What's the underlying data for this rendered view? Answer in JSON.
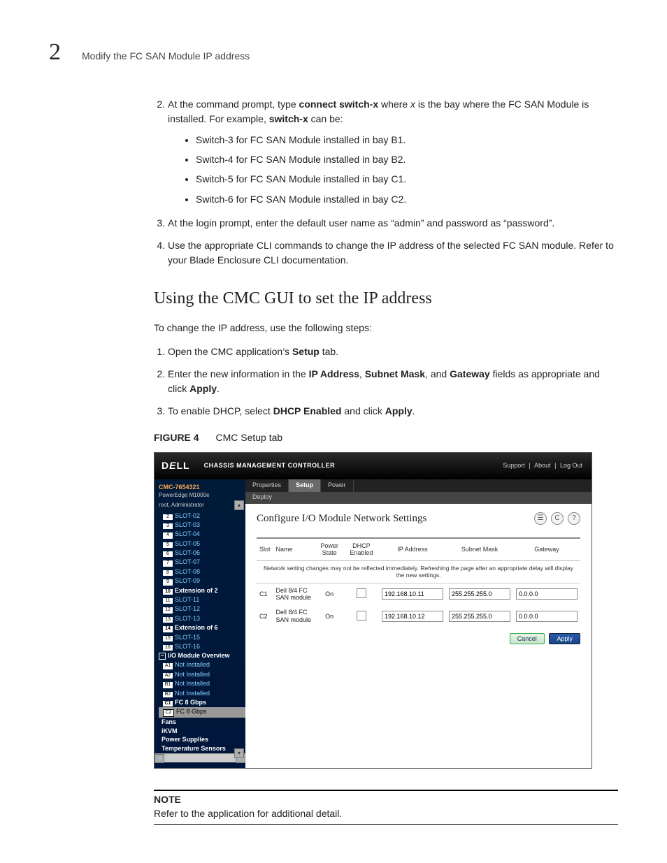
{
  "page": {
    "chapter_number": "2",
    "running_head": "Modify the FC SAN Module IP address"
  },
  "step2": {
    "num": "2.",
    "pre": "At the command prompt, type ",
    "cmd": "connect switch-x",
    "mid": " where ",
    "x": "x",
    "post": " is the bay where the FC SAN Module is installed. For example, ",
    "sx": "switch-x",
    "tail": " can be:",
    "bullets": [
      "Switch-3 for FC SAN Module installed in bay B1.",
      "Switch-4 for FC SAN Module installed in bay B2.",
      "Switch-5 for FC SAN Module installed in bay C1.",
      "Switch-6 for FC SAN Module installed in bay C2."
    ]
  },
  "step3": {
    "num": "3.",
    "text": "At the login prompt, enter the default user name as “admin” and password as “password”."
  },
  "step4": {
    "num": "4.",
    "text": "Use the appropriate CLI commands to change the IP address of the selected FC SAN module. Refer to your Blade Enclosure CLI documentation."
  },
  "section": {
    "title": "Using the CMC GUI to set the IP address",
    "intro": "To change the IP address, use the following steps:",
    "s1a": "Open the CMC application’s ",
    "s1b": "Setup",
    "s1c": " tab.",
    "s2a": "Enter the new information in the ",
    "s2_ip": "IP Address",
    "s2_sep1": ", ",
    "s2_sm": "Subnet Mask",
    "s2_sep2": ", and ",
    "s2_gw": "Gateway",
    "s2b": " fields as appropriate and click ",
    "s2_apply": "Apply",
    "s2c": ".",
    "s3a": "To enable DHCP, select ",
    "s3_dhcp": "DHCP Enabled",
    "s3b": " and click ",
    "s3_apply": "Apply",
    "s3c": "."
  },
  "figure": {
    "label": "FIGURE 4",
    "caption": "CMC Setup tab"
  },
  "cmc": {
    "brand": "DELL",
    "app_title": "CHASSIS MANAGEMENT CONTROLLER",
    "links": {
      "support": "Support",
      "about": "About",
      "logout": "Log Out"
    },
    "side": {
      "id": "CMC-7654321",
      "model": "PowerEdge M1000e",
      "user": "root, Administrator",
      "slots": [
        "SLOT-02",
        "SLOT-03",
        "SLOT-04",
        "SLOT-05",
        "SLOT-06",
        "SLOT-07",
        "SLOT-08",
        "SLOT-09"
      ],
      "slot_nums": [
        "2",
        "3",
        "4",
        "5",
        "6",
        "7",
        "8",
        "9"
      ],
      "ext2_num": "10",
      "ext2": "Extension of 2",
      "slots2": [
        "SLOT-11",
        "SLOT-12",
        "SLOT-13"
      ],
      "slot_nums2": [
        "11",
        "12",
        "13"
      ],
      "ext6_num": "14",
      "ext6": "Extension of 6",
      "slots3": [
        "SLOT-15",
        "SLOT-16"
      ],
      "slot_nums3": [
        "15",
        "16"
      ],
      "io_over": "I/O Module Overview",
      "a1n": "A1",
      "a1": "Not Installed",
      "a2n": "A2",
      "a2": "Not Installed",
      "b1n": "B1",
      "b1": "Not Installed",
      "b2n": "B2",
      "b2": "Not Installed",
      "c1n": "C1",
      "c1": "FC 8 Gbps",
      "c2n": "C2",
      "c2": "FC 8 Gbps",
      "fans": "Fans",
      "ikvm": "iKVM",
      "ps": "Power Supplies",
      "ts": "Temperature Sensors"
    },
    "tabs": {
      "properties": "Properties",
      "setup": "Setup",
      "power": "Power",
      "deploy": "Deploy"
    },
    "pane_title": "Configure I/O Module Network Settings",
    "icons": {
      "print": "☰",
      "refresh": "C",
      "help": "?"
    },
    "th": {
      "slot": "Slot",
      "name": "Name",
      "power": "Power State",
      "dhcp": "DHCP Enabled",
      "ip": "IP Address",
      "subnet": "Subnet Mask",
      "gw": "Gateway"
    },
    "warn": "Network setting changes may not be reflected immediately. Refreshing the page after an appropriate delay will display the new settings.",
    "rows": [
      {
        "slot": "C1",
        "name": "Dell 8/4 FC SAN module",
        "power": "On",
        "ip": "192.168.10.11",
        "subnet": "255.255.255.0",
        "gw": "0.0.0.0"
      },
      {
        "slot": "C2",
        "name": "Dell 8/4 FC SAN module",
        "power": "On",
        "ip": "192.168.10.12",
        "subnet": "255.255.255.0",
        "gw": "0.0.0.0"
      }
    ],
    "buttons": {
      "cancel": "Cancel",
      "apply": "Apply"
    }
  },
  "note": {
    "label": "NOTE",
    "text": "Refer to the application for additional detail."
  }
}
